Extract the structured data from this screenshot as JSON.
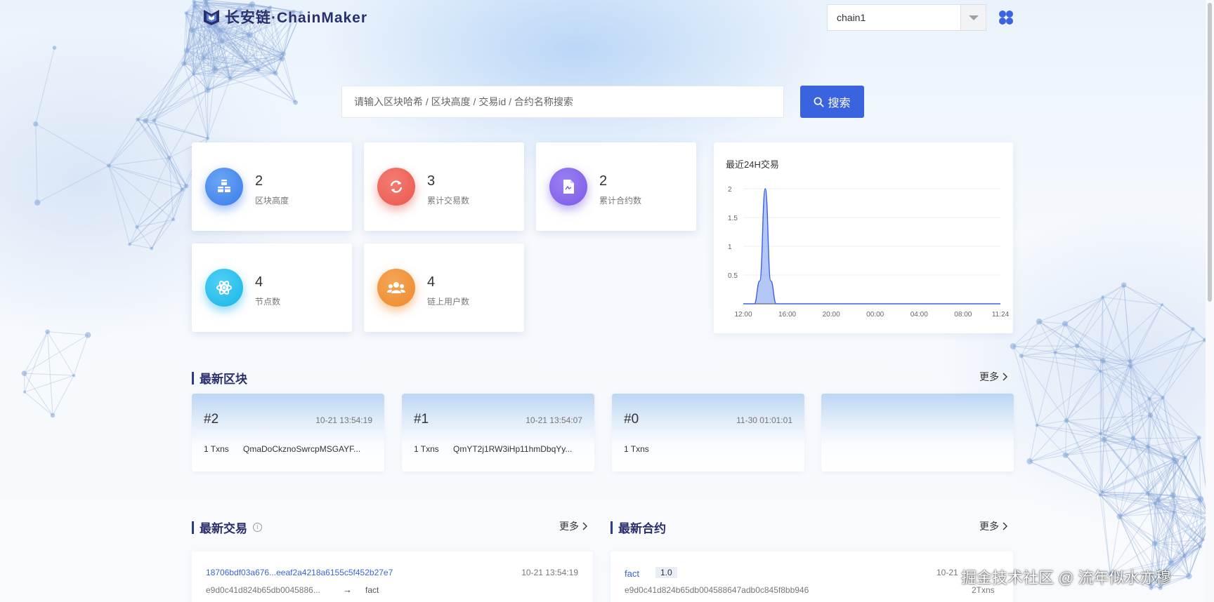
{
  "header": {
    "logo_text": "长安链·ChainMaker",
    "chain_select": {
      "value": "chain1"
    }
  },
  "search": {
    "placeholder": "请输入区块哈希 / 区块高度 / 交易id / 合约名称搜索",
    "button_label": "搜索"
  },
  "stats": [
    {
      "value": "2",
      "label": "区块高度",
      "icon": "cubes-icon",
      "color": "#3a7be8"
    },
    {
      "value": "3",
      "label": "累计交易数",
      "icon": "refresh-icon",
      "color": "#e8584e"
    },
    {
      "value": "2",
      "label": "累计合约数",
      "icon": "contract-icon",
      "color": "#7a5ae6"
    },
    {
      "value": "4",
      "label": "节点数",
      "icon": "node-icon",
      "color": "#19b5e6"
    },
    {
      "value": "4",
      "label": "链上用户数",
      "icon": "users-icon",
      "color": "#ee8a2a"
    }
  ],
  "chart_data": {
    "type": "area",
    "title": "最近24H交易",
    "x_tick_labels": [
      "12:00",
      "16:00",
      "20:00",
      "00:00",
      "04:00",
      "08:00",
      "11:24"
    ],
    "y_tick_labels": [
      "2",
      "1.5",
      "1",
      "0.5"
    ],
    "ylim": [
      0,
      2
    ],
    "series": [
      {
        "values": [
          {
            "x": "12:00",
            "y": 0
          },
          {
            "x": "13:00",
            "y": 0
          },
          {
            "x": "13:30",
            "y": 0.4
          },
          {
            "x": "14:00",
            "y": 2
          },
          {
            "x": "14:30",
            "y": 0.4
          },
          {
            "x": "15:00",
            "y": 0
          },
          {
            "x": "11:24",
            "y": 0
          }
        ]
      }
    ],
    "grid": true,
    "color": "#3a63e0"
  },
  "latest_blocks": {
    "title": "最新区块",
    "more_label": "更多",
    "items": [
      {
        "number": "#2",
        "time": "10-21 13:54:19",
        "txns": "1 Txns",
        "hash": "QmaDoCkznoSwrcpMSGAYF..."
      },
      {
        "number": "#1",
        "time": "10-21 13:54:07",
        "txns": "1 Txns",
        "hash": "QmYT2j1RW3iHp11hmDbqYy..."
      },
      {
        "number": "#0",
        "time": "11-30 01:01:01",
        "txns": "1 Txns",
        "hash": ""
      }
    ]
  },
  "latest_txs": {
    "title": "最新交易",
    "more_label": "更多",
    "info_glyph": "i",
    "arrow_glyph": "→",
    "items": [
      {
        "hash": "18706bdf03a676...eeaf2a4218a6155c5f452b27e7",
        "time": "10-21 13:54:19",
        "from": "e9d0c41d824b65db0045886...",
        "to": "fact"
      }
    ]
  },
  "latest_contracts": {
    "title": "最新合约",
    "more_label": "更多",
    "items": [
      {
        "name": "fact",
        "version": "1.0",
        "time": "10-21",
        "creator": "e9d0c41d824b65db004588647adb0c845f8bb946",
        "txns": "2Txns"
      }
    ]
  },
  "watermark": "掘金技术社区 @ 流年似水亦穆"
}
